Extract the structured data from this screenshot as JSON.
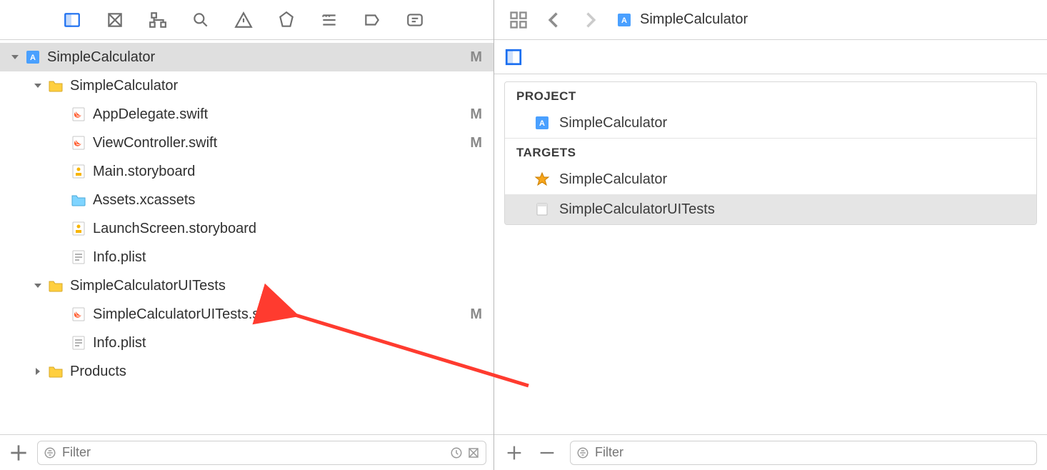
{
  "navigator": {
    "toolbar_icons": [
      "project",
      "symbol",
      "hierarchy",
      "find",
      "issues",
      "tests",
      "debug",
      "breakpoints",
      "reports"
    ],
    "tree": [
      {
        "depth": 0,
        "expanded": true,
        "icon": "project",
        "label": "SimpleCalculator",
        "status": "M",
        "selected": true
      },
      {
        "depth": 1,
        "expanded": true,
        "icon": "folder",
        "label": "SimpleCalculator"
      },
      {
        "depth": 2,
        "icon": "swift",
        "label": "AppDelegate.swift",
        "status": "M"
      },
      {
        "depth": 2,
        "icon": "swift",
        "label": "ViewController.swift",
        "status": "M"
      },
      {
        "depth": 2,
        "icon": "storyboard",
        "label": "Main.storyboard"
      },
      {
        "depth": 2,
        "icon": "assets",
        "label": "Assets.xcassets"
      },
      {
        "depth": 2,
        "icon": "storyboard",
        "label": "LaunchScreen.storyboard"
      },
      {
        "depth": 2,
        "icon": "plist",
        "label": "Info.plist"
      },
      {
        "depth": 1,
        "expanded": true,
        "icon": "folder",
        "label": "SimpleCalculatorUITests"
      },
      {
        "depth": 2,
        "icon": "swift",
        "label": "SimpleCalculatorUITests.swift",
        "status": "M"
      },
      {
        "depth": 2,
        "icon": "plist",
        "label": "Info.plist"
      },
      {
        "depth": 1,
        "expanded": false,
        "icon": "folder",
        "label": "Products"
      }
    ],
    "filter_placeholder": "Filter"
  },
  "editor": {
    "breadcrumb": {
      "icon": "project",
      "label": "SimpleCalculator"
    },
    "sections": {
      "project_header": "PROJECT",
      "project_items": [
        {
          "icon": "project",
          "label": "SimpleCalculator"
        }
      ],
      "targets_header": "TARGETS",
      "target_items": [
        {
          "icon": "app",
          "label": "SimpleCalculator",
          "selected": false
        },
        {
          "icon": "uitest",
          "label": "SimpleCalculatorUITests",
          "selected": true
        }
      ]
    },
    "filter_placeholder": "Filter"
  }
}
